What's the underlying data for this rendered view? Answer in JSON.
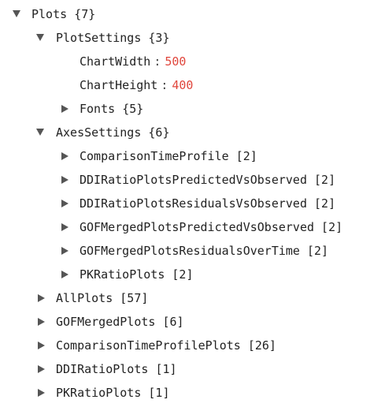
{
  "tree": {
    "root": {
      "key": "Plots",
      "count": "{7}"
    },
    "plot_settings": {
      "key": "PlotSettings",
      "count": "{3}",
      "chart_width": {
        "key": "ChartWidth",
        "sep": ":",
        "value": "500"
      },
      "chart_height": {
        "key": "ChartHeight",
        "sep": ":",
        "value": "400"
      },
      "fonts": {
        "key": "Fonts",
        "count": "{5}"
      }
    },
    "axes_settings": {
      "key": "AxesSettings",
      "count": "{6}",
      "items": [
        {
          "key": "ComparisonTimeProfile",
          "count": "[2]"
        },
        {
          "key": "DDIRatioPlotsPredictedVsObserved",
          "count": "[2]"
        },
        {
          "key": "DDIRatioPlotsResidualsVsObserved",
          "count": "[2]"
        },
        {
          "key": "GOFMergedPlotsPredictedVsObserved",
          "count": "[2]"
        },
        {
          "key": "GOFMergedPlotsResidualsOverTime",
          "count": "[2]"
        },
        {
          "key": "PKRatioPlots",
          "count": "[2]"
        }
      ]
    },
    "others": [
      {
        "key": "AllPlots",
        "count": "[57]"
      },
      {
        "key": "GOFMergedPlots",
        "count": "[6]"
      },
      {
        "key": "ComparisonTimeProfilePlots",
        "count": "[26]"
      },
      {
        "key": "DDIRatioPlots",
        "count": "[1]"
      },
      {
        "key": "PKRatioPlots",
        "count": "[1]"
      }
    ]
  },
  "icons": {
    "expanded": "caret-down-icon",
    "collapsed": "caret-right-icon"
  },
  "colors": {
    "text": "#222222",
    "value": "#e0463c",
    "caret": "#555555"
  }
}
